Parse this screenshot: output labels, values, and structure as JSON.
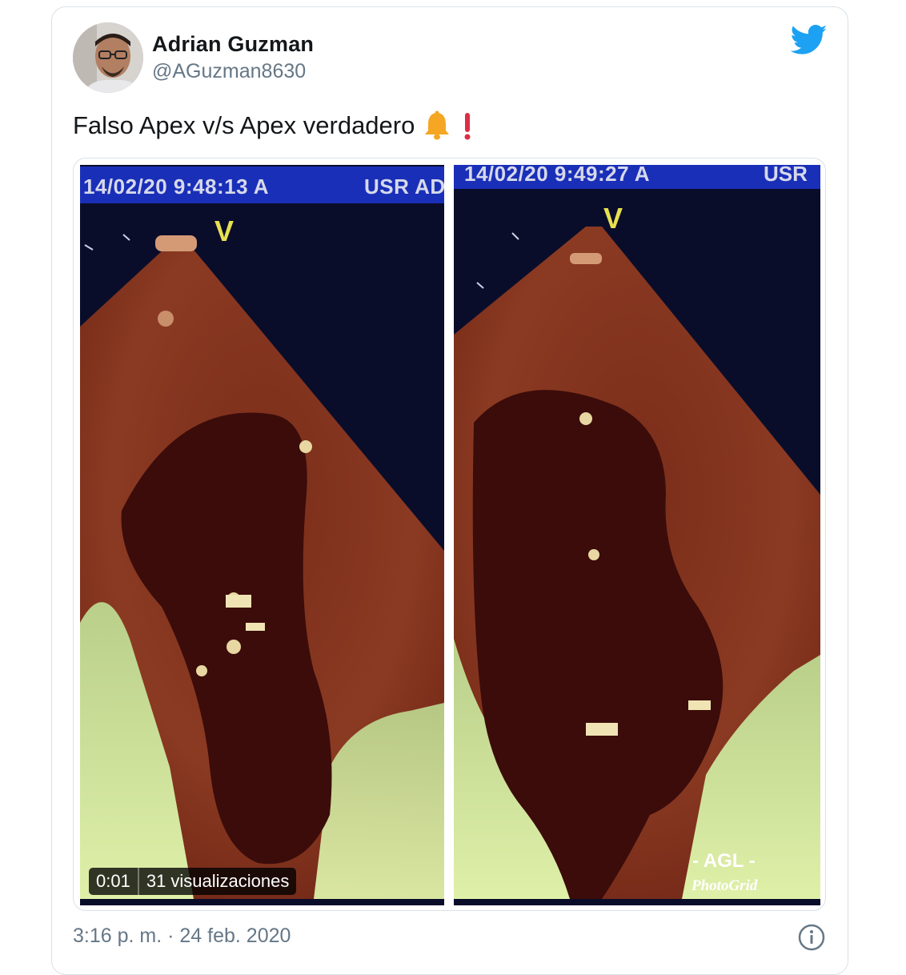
{
  "tweet": {
    "author_name": "Adrian Guzman",
    "handle": "@AGuzman8630",
    "text": "Falso Apex v/s Apex verdadero",
    "emojis": [
      "bell-icon",
      "exclamation-icon"
    ],
    "timestamp": "3:16 p. m. · 24 feb. 2020"
  },
  "media": {
    "left_frame": {
      "datetime": "14/02/20 9:48:13 A",
      "header_right": "USR AD",
      "marker": "V"
    },
    "right_frame": {
      "datetime": "14/02/20 9:49:27 A",
      "header_right": "USR",
      "marker": "V",
      "watermark_line1": "- AGL -",
      "watermark_line2": "PhotoGrid"
    },
    "video_time": "0:01",
    "views": "31 visualizaciones"
  },
  "colors": {
    "twitter_blue": "#1da1f2",
    "text_primary": "#14171a",
    "text_secondary": "#657786",
    "ultrasound_header": "#1a2fb8",
    "marker_yellow": "#e8e050"
  },
  "icons": {
    "brand": "twitter-bird-icon",
    "info": "info-icon"
  }
}
